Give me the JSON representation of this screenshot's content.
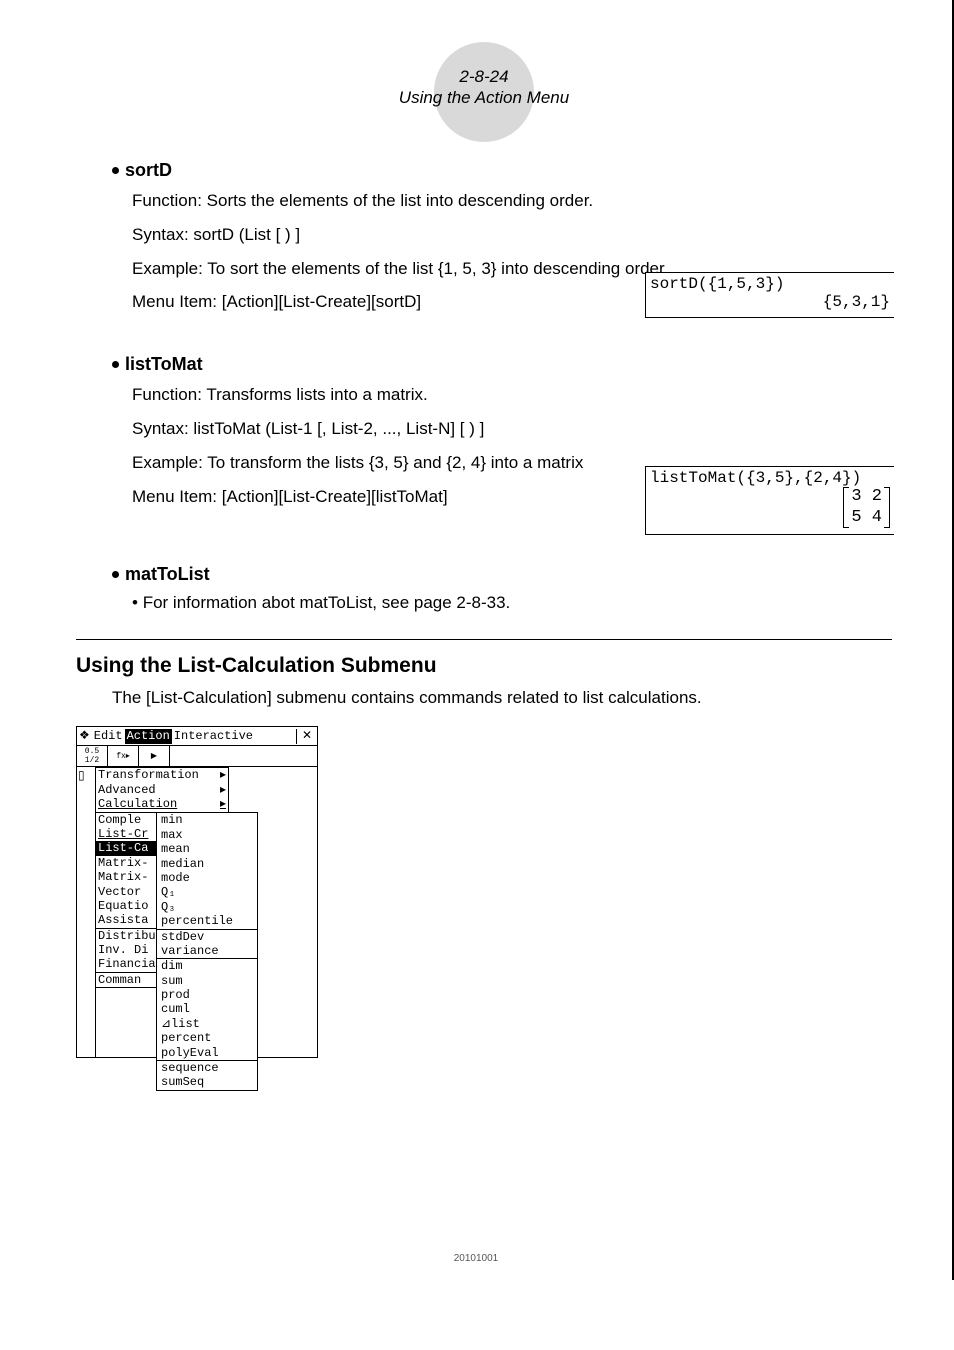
{
  "header": {
    "chapter_num": "2-8-24",
    "chapter_title": "Using the Action Menu"
  },
  "sortD": {
    "title": "sortD",
    "function": "Function: Sorts the elements of the list into descending order.",
    "syntax": "Syntax: sortD (List [ ) ]",
    "example": "Example: To sort the elements of the list {1, 5, 3} into descending order",
    "menu": "Menu Item: [Action][List-Create][sortD]",
    "calc_in": "sortD({1,5,3})",
    "calc_out": "{5,3,1}"
  },
  "listToMat": {
    "title": "listToMat",
    "function": "Function: Transforms lists into a matrix.",
    "syntax": "Syntax: listToMat (List-1 [, List-2, ..., List-N] [ ) ]",
    "example": "Example: To transform the lists {3, 5} and {2, 4} into a matrix",
    "menu": "Menu Item: [Action][List-Create][listToMat]",
    "calc_in": "listToMat({3,5},{2,4})",
    "mat_r1": "3 2",
    "mat_r2": "5 4"
  },
  "matToList": {
    "title": "matToList",
    "note": "For information abot matToList, see page 2-8-33."
  },
  "section": {
    "heading": "Using the List-Calculation Submenu",
    "intro": "The [List-Calculation] submenu contains commands related to list calculations."
  },
  "menubar": {
    "app": "❖",
    "edit": "Edit",
    "action": "Action",
    "interactive": "Interactive",
    "close": "✕"
  },
  "menu1": {
    "transformation": "Transformation",
    "advanced": "Advanced",
    "calculation": "Calculation",
    "complex": "Comple",
    "listCreate": "List-Cr",
    "listCalc": "List-Ca",
    "matrixCreate": "Matrix-",
    "matrixCalc": "Matrix-",
    "vector": "Vector",
    "equation": "Equatio",
    "assistant": "Assista",
    "distribution": "Distribu",
    "invDist": "Inv. Di",
    "financial": "Financia",
    "command": "Comman"
  },
  "menu2": {
    "min": "min",
    "max": "max",
    "mean": "mean",
    "median": "median",
    "mode": "mode",
    "q1": "Q₁",
    "q3": "Q₃",
    "percentile": "percentile",
    "stdDev": "stdDev",
    "variance": "variance",
    "dim": "dim",
    "sum": "sum",
    "prod": "prod",
    "cuml": "cuml",
    "dlist": "⊿list",
    "percent": "percent",
    "polyEval": "polyEval",
    "sequence": "sequence",
    "sumSeq": "sumSeq"
  },
  "footer": "20101001"
}
